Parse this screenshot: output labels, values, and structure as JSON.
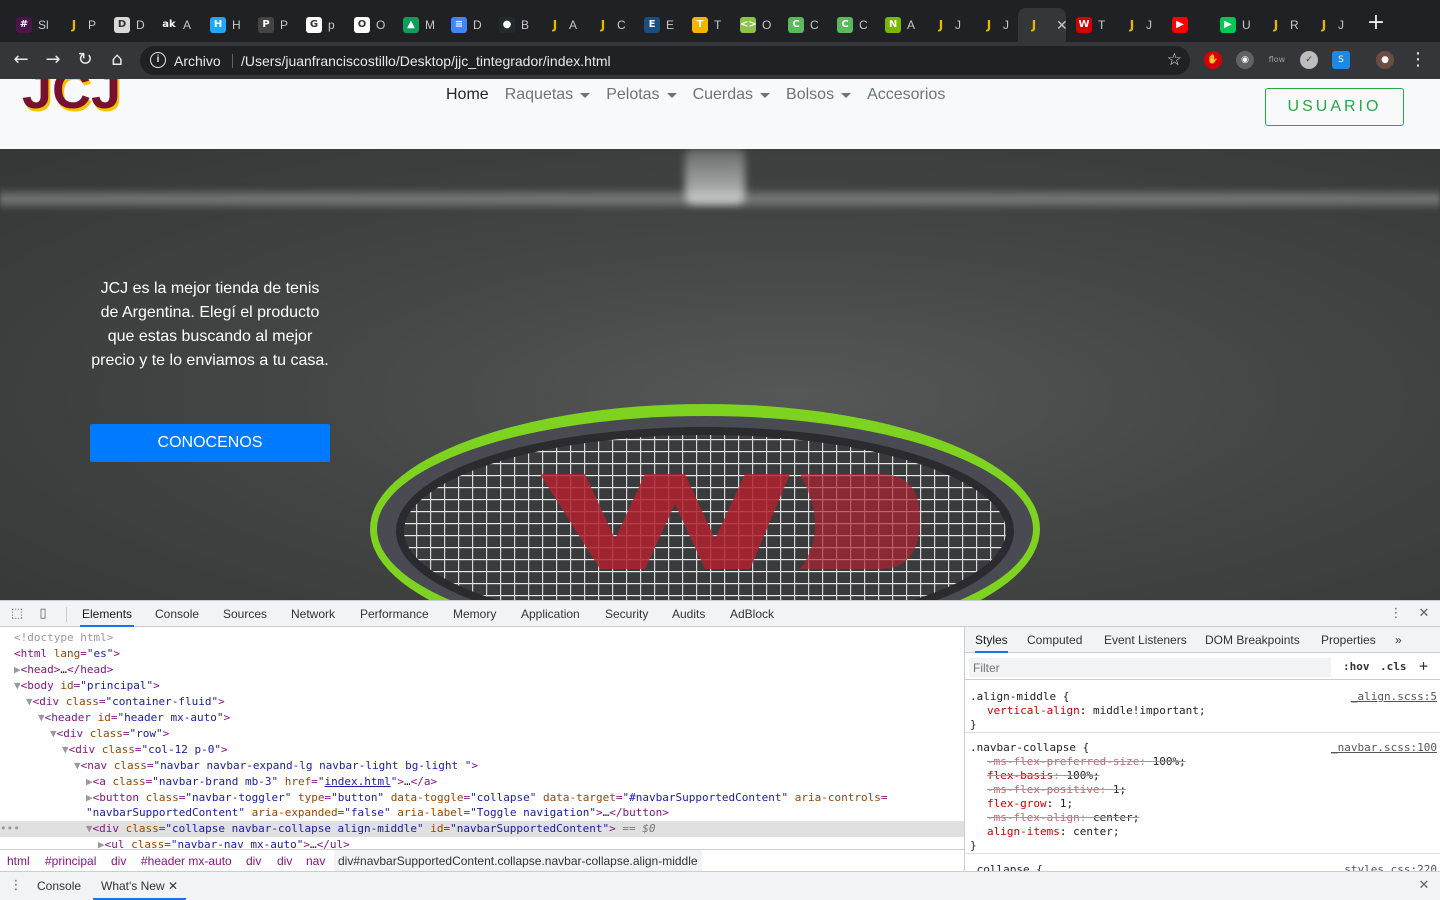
{
  "browser": {
    "tabs": [
      {
        "icon": "slack-icon",
        "label": "Sl",
        "color": "#4a154b",
        "glyph": "#"
      },
      {
        "icon": "jcj-icon",
        "label": "P",
        "color": "#e6b800",
        "glyph": "J"
      },
      {
        "icon": "doc-icon",
        "label": "D",
        "color": "#d9d9d9",
        "glyph": "D"
      },
      {
        "icon": "ak-icon",
        "label": "A",
        "color": "#202124",
        "glyph": "ak"
      },
      {
        "icon": "hh-icon",
        "label": "H",
        "color": "#1ea7fd",
        "glyph": "H"
      },
      {
        "icon": "poker-icon",
        "label": "P",
        "color": "#444444",
        "glyph": "P"
      },
      {
        "icon": "google-icon",
        "label": "p",
        "color": "#ffffff",
        "glyph": "G"
      },
      {
        "icon": "opera-icon",
        "label": "O",
        "color": "#ffffff",
        "glyph": "O"
      },
      {
        "icon": "drive-icon",
        "label": "M",
        "color": "#0f9d58",
        "glyph": "▲"
      },
      {
        "icon": "docs-icon",
        "label": "D",
        "color": "#4285f4",
        "glyph": "≡"
      },
      {
        "icon": "github-icon",
        "label": "B",
        "color": "#24292e",
        "glyph": "●"
      },
      {
        "icon": "jcj-icon",
        "label": "A",
        "color": "#e6b800",
        "glyph": "J"
      },
      {
        "icon": "jcj-icon",
        "label": "C",
        "color": "#e6b800",
        "glyph": "J"
      },
      {
        "icon": "ea-icon",
        "label": "E",
        "color": "#1c4e7d",
        "glyph": "E"
      },
      {
        "icon": "tennis-icon",
        "label": "T",
        "color": "#f4b400",
        "glyph": "T"
      },
      {
        "icon": "code-icon",
        "label": "O",
        "color": "#8bc34a",
        "glyph": "<>"
      },
      {
        "icon": "cq-icon",
        "label": "C",
        "color": "#5cb85c",
        "glyph": "C"
      },
      {
        "icon": "cq-icon",
        "label": "C",
        "color": "#5cb85c",
        "glyph": "C"
      },
      {
        "icon": "nvidia-icon",
        "label": "A",
        "color": "#76b900",
        "glyph": "N"
      },
      {
        "icon": "jcj-icon",
        "label": "J",
        "color": "#e6b800",
        "glyph": "J"
      },
      {
        "icon": "jcj-icon",
        "label": "J",
        "color": "#e6b800",
        "glyph": "J"
      },
      {
        "icon": "jcj-icon",
        "label": "",
        "color": "#e6b800",
        "glyph": "J",
        "active": true
      },
      {
        "icon": "wilson-icon",
        "label": "T",
        "color": "#d50000",
        "glyph": "W"
      },
      {
        "icon": "jcj-icon",
        "label": "J",
        "color": "#e6b800",
        "glyph": "J"
      },
      {
        "icon": "youtube-icon",
        "label": "",
        "color": "#ff0000",
        "glyph": "▶"
      },
      {
        "icon": "play-icon",
        "label": "U",
        "color": "#00c853",
        "glyph": "▶"
      },
      {
        "icon": "jcj-icon",
        "label": "R",
        "color": "#e6b800",
        "glyph": "J"
      },
      {
        "icon": "jcj-icon",
        "label": "J",
        "color": "#e6b800",
        "glyph": "J"
      }
    ],
    "omnibox": {
      "scheme": "Archivo",
      "url": "/Users/juanfranciscostillo/Desktop/jjc_tintegrador/index.html"
    }
  },
  "page": {
    "brand": "JCJ",
    "nav": [
      {
        "label": "Home",
        "active": true,
        "dropdown": false
      },
      {
        "label": "Raquetas",
        "dropdown": true
      },
      {
        "label": "Pelotas",
        "dropdown": true
      },
      {
        "label": "Cuerdas",
        "dropdown": true
      },
      {
        "label": "Bolsos",
        "dropdown": true
      },
      {
        "label": "Accesorios",
        "dropdown": false
      }
    ],
    "user_button": "USUARIO",
    "hero_text": "JCJ es la mejor tienda de tenis de Argentina. Elegí el producto que estas buscando al mejor precio y te lo enviamos a tu casa.",
    "hero_button": "CONOCENOS"
  },
  "devtools": {
    "tabs": [
      "Elements",
      "Console",
      "Sources",
      "Network",
      "Performance",
      "Memory",
      "Application",
      "Security",
      "Audits",
      "AdBlock"
    ],
    "active_tab": "Elements",
    "breadcrumbs": [
      "html",
      "#principal",
      "div",
      "#header mx-auto",
      "div",
      "div",
      "nav",
      "div#navbarSupportedContent.collapse.navbar-collapse.align-middle"
    ],
    "styles_tabs": [
      "Styles",
      "Computed",
      "Event Listeners",
      "DOM Breakpoints",
      "Properties",
      "»"
    ],
    "filter_placeholder": "Filter",
    "filter_tools": [
      ":hov",
      ".cls",
      "+"
    ],
    "rules": [
      {
        "selector": ".align-middle {",
        "source": "_align.scss:5",
        "decls": [
          {
            "prop": "vertical-align",
            "value": "middle!important;",
            "struck": false
          }
        ]
      },
      {
        "selector": ".navbar-collapse {",
        "source": "_navbar.scss:100",
        "decls": [
          {
            "prop": "-ms-flex-preferred-size",
            "value": "100%;",
            "struck": true,
            "dark": false
          },
          {
            "prop": "flex-basis",
            "value": "100%;",
            "struck": true,
            "dark": true
          },
          {
            "prop": "-ms-flex-positive",
            "value": "1;",
            "struck": true,
            "dark": false
          },
          {
            "prop": "flex-grow",
            "value": "1;",
            "struck": false
          },
          {
            "prop": "-ms-flex-align",
            "value": "center;",
            "struck": true,
            "dark": false
          },
          {
            "prop": "align-items",
            "value": "center;",
            "struck": false
          }
        ]
      },
      {
        "selector": ".collapse {",
        "source": "styles.css:220",
        "decls": []
      }
    ],
    "drawer_tabs": [
      "Console",
      "What's New"
    ]
  }
}
